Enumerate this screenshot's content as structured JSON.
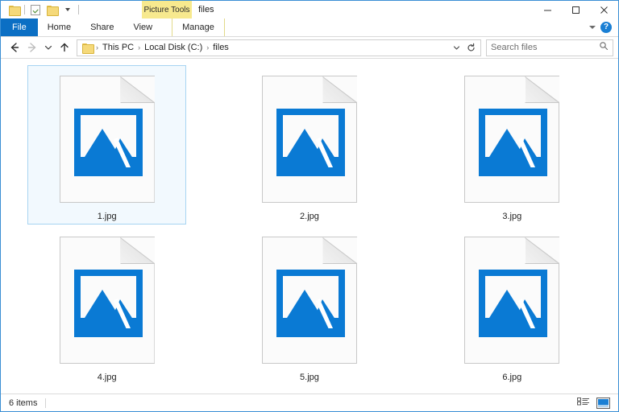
{
  "window": {
    "title": "files",
    "contextual_tool_label": "Picture Tools",
    "quick_access": [
      {
        "name": "folder-icon",
        "label": ""
      },
      {
        "name": "properties-icon",
        "label": ""
      },
      {
        "name": "new-folder-icon",
        "label": ""
      },
      {
        "name": "customize-qat-icon",
        "label": ""
      }
    ],
    "controls": {
      "minimize": "Minimize",
      "maximize": "Maximize",
      "close": "Close"
    }
  },
  "ribbon": {
    "tabs": [
      {
        "label": "File",
        "active_style": "file"
      },
      {
        "label": "Home",
        "active_style": "normal"
      },
      {
        "label": "Share",
        "active_style": "normal"
      },
      {
        "label": "View",
        "active_style": "normal"
      },
      {
        "label": "Manage",
        "active_style": "contextual"
      }
    ],
    "collapse_label": "",
    "help_label": "?"
  },
  "address": {
    "back_label": "Back",
    "forward_label": "Forward",
    "recent_label": "Recent locations",
    "up_label": "Up",
    "breadcrumb": [
      {
        "label": "This PC"
      },
      {
        "label": "Local Disk (C:)"
      },
      {
        "label": "files"
      }
    ],
    "separator": "›",
    "dropdown_label": "",
    "refresh_label": "Refresh"
  },
  "search": {
    "placeholder": "Search files",
    "value": ""
  },
  "files": [
    {
      "name": "1.jpg",
      "type": "jpg",
      "selected": true
    },
    {
      "name": "2.jpg",
      "type": "jpg",
      "selected": false
    },
    {
      "name": "3.jpg",
      "type": "jpg",
      "selected": false
    },
    {
      "name": "4.jpg",
      "type": "jpg",
      "selected": false
    },
    {
      "name": "5.jpg",
      "type": "jpg",
      "selected": false
    },
    {
      "name": "6.jpg",
      "type": "jpg",
      "selected": false
    }
  ],
  "status": {
    "item_count_text": "6 items",
    "view_details_label": "Details view",
    "view_large_icons_label": "Large icons view",
    "active_view": "large-icons"
  },
  "colors": {
    "accent_blue": "#0b6fc4",
    "icon_blue": "#0a7ad4",
    "contextual_yellow": "#f7e98e",
    "selection_fill": "#f2f9fe",
    "selection_border": "#a7d4f2",
    "window_border": "#3a8fd4"
  }
}
